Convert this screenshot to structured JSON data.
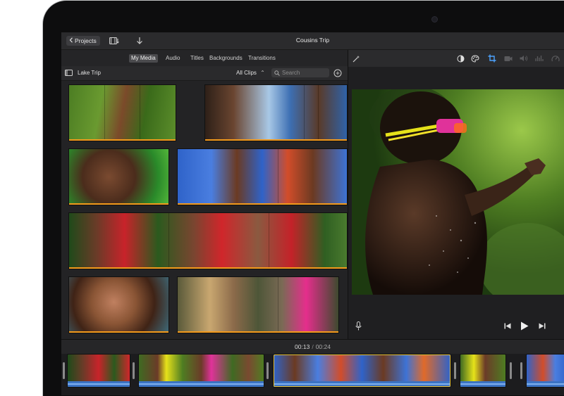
{
  "toolbar": {
    "projects_label": "Projects",
    "title": "Cousins Trip"
  },
  "tabs": [
    {
      "label": "My Media",
      "active": true
    },
    {
      "label": "Audio",
      "active": false
    },
    {
      "label": "Titles",
      "active": false
    },
    {
      "label": "Backgrounds",
      "active": false
    },
    {
      "label": "Transitions",
      "active": false
    }
  ],
  "library": {
    "name": "Lake Trip",
    "filter_label": "All Clips",
    "search_placeholder": "Search"
  },
  "viewer_tools": [
    "magic-wand",
    "color-balance",
    "color-correction",
    "crop",
    "stabilization",
    "volume",
    "noise-reduction",
    "speed"
  ],
  "timecode": {
    "current": "00:13",
    "separator": "/",
    "duration": "00:24"
  },
  "colors": {
    "accent_orange": "#f39a1c",
    "audio_blue": "#3b73c4",
    "selection_yellow": "#e8c23a"
  }
}
